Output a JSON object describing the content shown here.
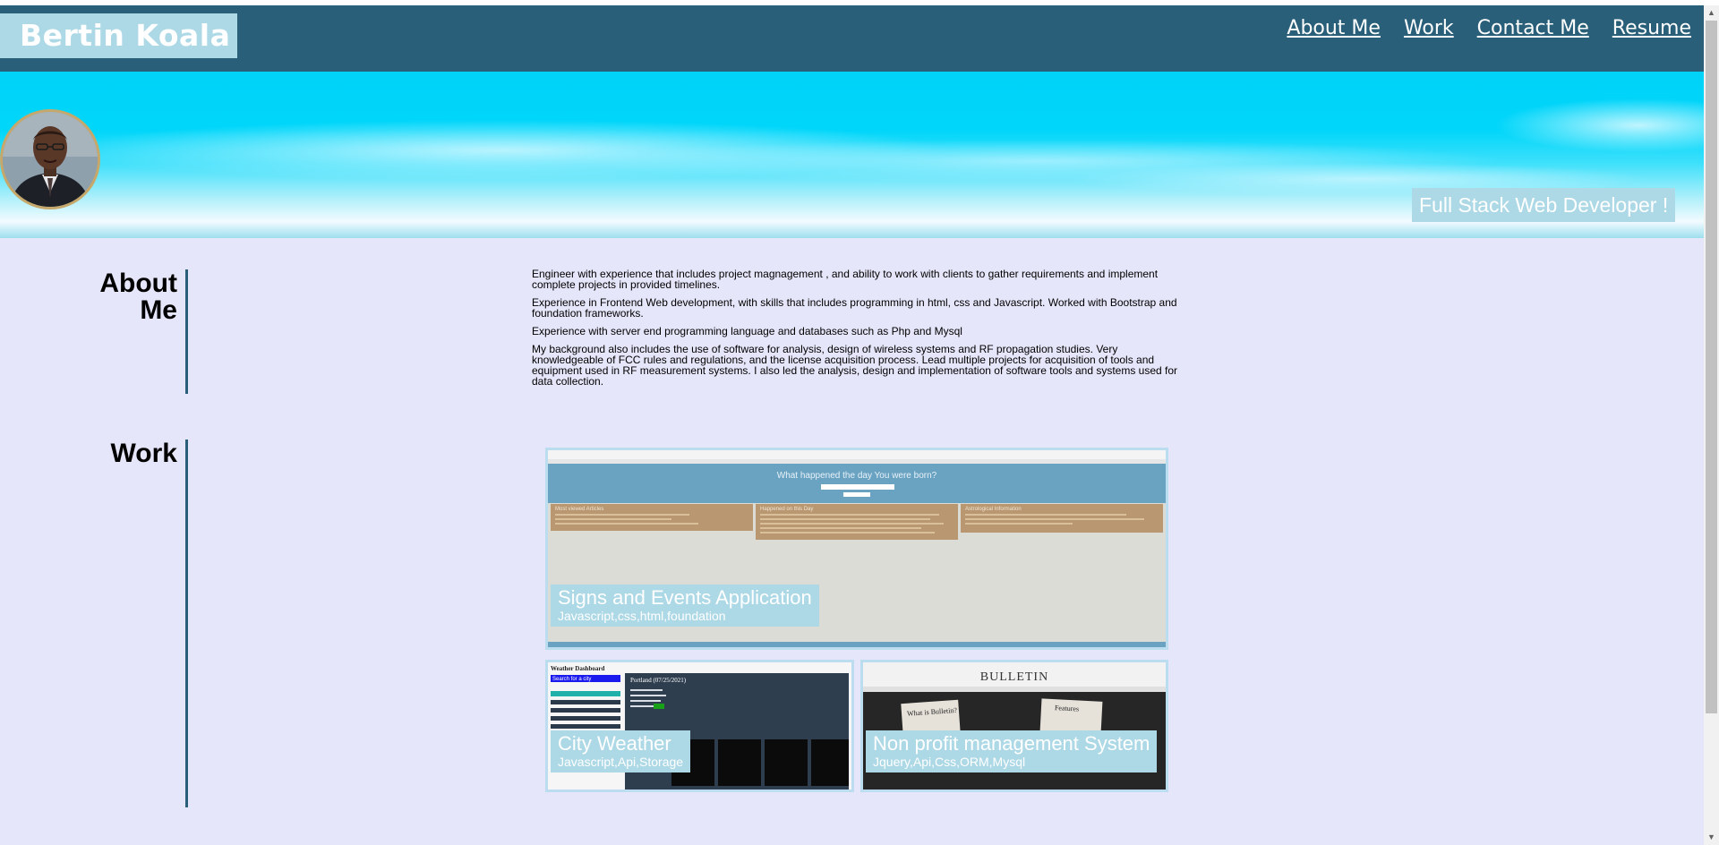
{
  "brand": "Bertin Koala",
  "nav": [
    "About Me",
    "Work",
    "Contact Me",
    "Resume"
  ],
  "hero": {
    "tagline": "Full Stack Web Developer !"
  },
  "about": {
    "title_line1": "About",
    "title_line2": "Me",
    "paragraphs": [
      "Engineer with experience that includes project magnagement , and ability to work with clients to gather requirements and implement complete projects in provided timelines.",
      "Experience in Frontend Web development, with skills that includes programming in html, css and Javascript. Worked with Bootstrap and foundation frameworks.",
      "Experience with server end programming language and databases such as Php and Mysql",
      "My background also includes the use of software for analysis, design of wireless systems and RF propagation studies. Very knowledgeable of FCC rules and regulations, and the license acquisition process. Lead multiple projects for acquisition of tools and equipment used in RF measurement systems. I also led the analysis, design and implementation of software tools and systems used for data collection."
    ]
  },
  "work": {
    "title": "Work",
    "projects": [
      {
        "title": "Signs and Events Application",
        "tech": "Javascript,css,html,foundation",
        "shot_heading": "What happened the day You were born?",
        "shot_columns": [
          "Most viewed Articles",
          "Happened on this Day",
          "Astrological Information"
        ]
      },
      {
        "title": "City Weather",
        "tech": "Javascript,Api,Storage",
        "shot_heading": "Weather Dashboard",
        "shot_search": "Search for a city",
        "shot_city": "Portland (07/25/2021)"
      },
      {
        "title": "Non profit management System",
        "tech": "Jquery,Api,Css,ORM,Mysql",
        "shot_heading": "BULLETIN",
        "shot_note_left": "What is Bulletin?",
        "shot_note_right": "Features"
      }
    ]
  },
  "colors": {
    "navbar": "#2a5f7a",
    "accent_label": "#add8e6",
    "page_background": "#e6e6fa",
    "hero_cyan": "#00d4f8"
  },
  "icons": [
    "scroll-up-arrow-icon",
    "scroll-down-arrow-icon"
  ]
}
